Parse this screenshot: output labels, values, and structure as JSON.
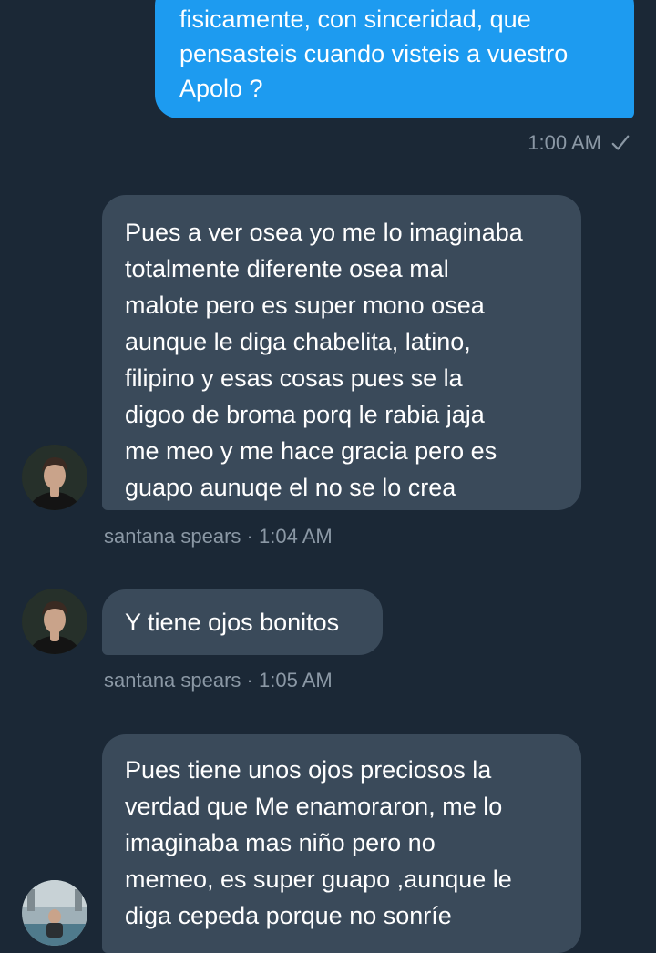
{
  "messages": [
    {
      "direction": "sent",
      "text": "fisicamente, con sinceridad, que\npensasteis cuando visteis a vuestro\nApolo ?",
      "time": "1:00 AM",
      "status_icon": "check-icon"
    },
    {
      "direction": "received",
      "text": "Pues a ver osea yo me lo imaginaba\ntotalmente diferente osea mal\nmalote pero es super mono osea\naunque le diga chabelita, latino,\nfilipino y esas cosas pues se la\ndigoo de broma porq le rabia jaja\nme meo y me hace gracia pero es\nguapo aunuqe el no se lo crea",
      "meta": "santana spears · 1:04 AM"
    },
    {
      "direction": "received",
      "text": "Y tiene ojos bonitos",
      "meta": "santana spears · 1:05 AM"
    },
    {
      "direction": "received",
      "text": "Pues tiene unos ojos preciosos la\nverdad que Me enamoraron, me lo\nimaginaba mas niño pero no\nmemeo, es super guapo ,aunque le\ndiga cepeda porque no sonríe",
      "meta": ""
    }
  ],
  "colors": {
    "background": "#1b2836",
    "sent_bubble": "#1d9bf0",
    "received_bubble": "#3a4a5a",
    "meta_text": "#8b98a5"
  }
}
